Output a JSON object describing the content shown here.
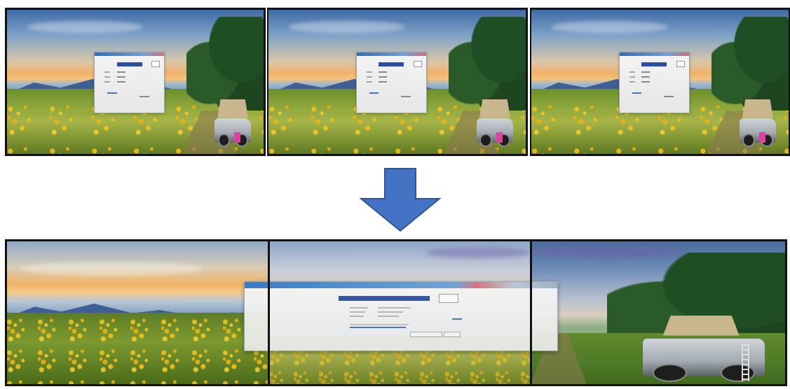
{
  "top_row": {
    "screens": [
      {
        "id": "screen-1",
        "content": "landscape-wallpaper-with-dialog"
      },
      {
        "id": "screen-2",
        "content": "landscape-wallpaper-with-dialog"
      },
      {
        "id": "screen-3",
        "content": "landscape-wallpaper-with-dialog"
      }
    ]
  },
  "arrow": {
    "icon": "down-arrow-icon",
    "color": "#4472c4",
    "stroke": "#2f5597"
  },
  "bottom_wall": {
    "panels": 3,
    "dialog": {
      "titlebar_colors": [
        "#2f78c9",
        "#6ea2d6",
        "#d66f7e"
      ],
      "field_color": "#2f4ea8"
    }
  },
  "colors": {
    "bezel": "#111111",
    "dialog_bg": "#eeeeee",
    "link": "#3c74c9"
  }
}
